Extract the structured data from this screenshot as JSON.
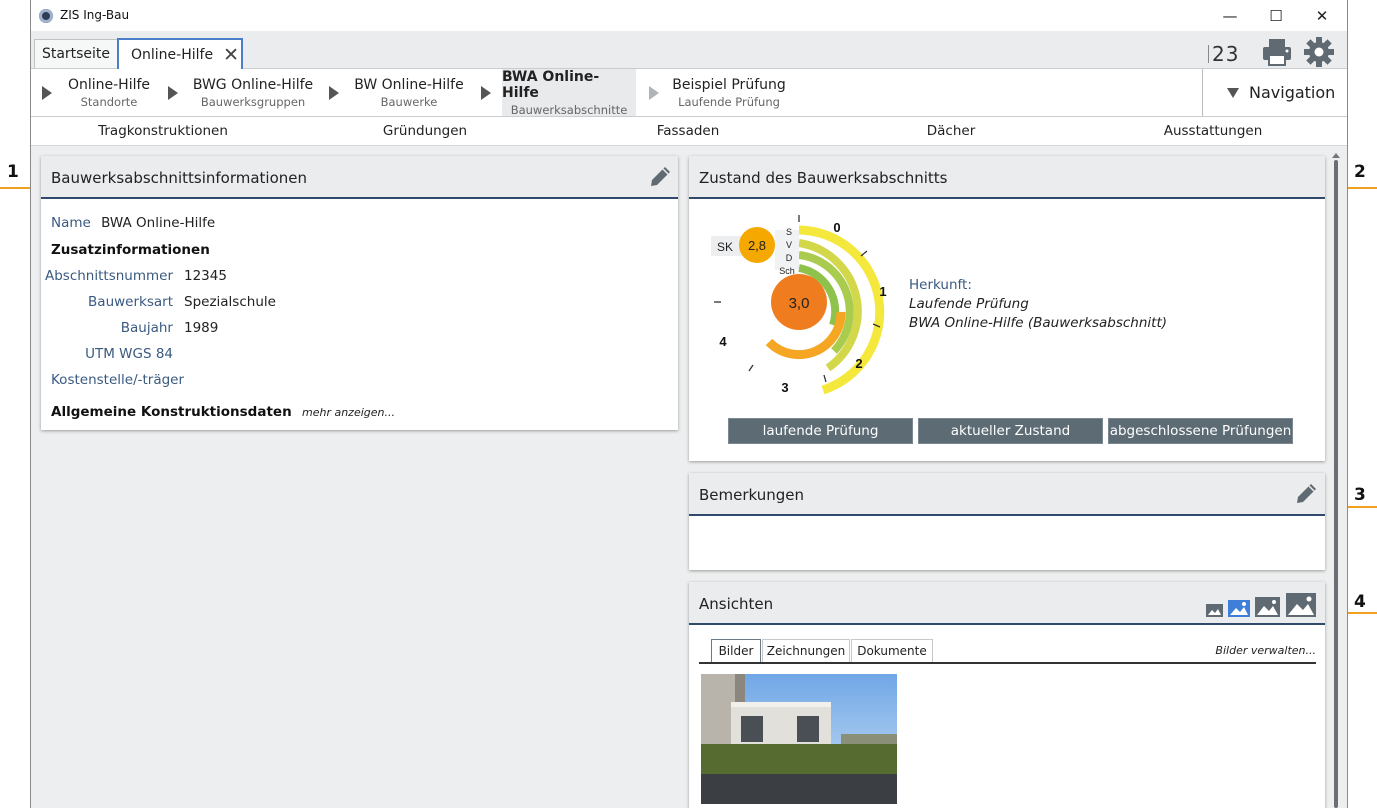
{
  "window": {
    "title": "ZIS Ing-Bau",
    "minimize": "—",
    "maximize": "☐",
    "close": "✕"
  },
  "tabs": {
    "start": "Startseite",
    "active": "Online-Hilfe",
    "close_glyph": "✕"
  },
  "toolbar": {
    "numbers": "23"
  },
  "breadcrumb": [
    {
      "title": "Online-Hilfe",
      "sub": "Standorte"
    },
    {
      "title": "BWG Online-Hilfe",
      "sub": "Bauwerksgruppen"
    },
    {
      "title": "BW Online-Hilfe",
      "sub": "Bauwerke"
    },
    {
      "title": "BWA Online-Hilfe",
      "sub": "Bauwerksabschnitte"
    },
    {
      "title": "Beispiel Prüfung",
      "sub": "Laufende Prüfung"
    }
  ],
  "navigation": {
    "label": "Navigation"
  },
  "categories": [
    "Tragkonstruktionen",
    "Gründungen",
    "Fassaden",
    "Dächer",
    "Ausstattungen"
  ],
  "info_panel": {
    "title": "Bauwerksabschnittsinformationen",
    "name_label": "Name",
    "name_value": "BWA Online-Hilfe",
    "zusatz": "Zusatzinformationen",
    "fields": [
      {
        "label": "Abschnittsnummer",
        "value": "12345"
      },
      {
        "label": "Bauwerksart",
        "value": "Spezialschule"
      },
      {
        "label": "Baujahr",
        "value": "1989"
      },
      {
        "label": "UTM WGS 84",
        "value": ""
      },
      {
        "label": "Kostenstelle/-träger",
        "value": ""
      }
    ],
    "allgemein": "Allgemeine Konstruktionsdaten",
    "mehr": "mehr anzeigen..."
  },
  "zustand_panel": {
    "title": "Zustand des Bauwerksabschnitts",
    "sk_label": "SK",
    "sk_value": "2,8",
    "center_value": "3,0",
    "ring_labels": [
      "S",
      "V",
      "D",
      "Sch"
    ],
    "scale_labels": [
      "0",
      "1",
      "2",
      "3",
      "4"
    ],
    "herkunft_label": "Herkunft:",
    "herkunft_line1": "Laufende Prüfung",
    "herkunft_line2": "BWA Online-Hilfe (Bauwerksabschnitt)",
    "buttons": [
      "laufende Prüfung",
      "aktueller Zustand",
      "abgeschlossene Prüfungen"
    ],
    "colors": {
      "ring_s": "#f5e83c",
      "ring_v": "#d2d84a",
      "ring_d": "#a9cc4e",
      "ring_sch": "#8fc24a",
      "center": "#ef7d1f",
      "sk_badge": "#f5a900"
    }
  },
  "bemerkungen_panel": {
    "title": "Bemerkungen"
  },
  "ansichten_panel": {
    "title": "Ansichten",
    "tabs": [
      "Bilder",
      "Zeichnungen",
      "Dokumente"
    ],
    "manage": "Bilder verwalten...",
    "image_icons": [
      "image-small-icon",
      "image-medium-icon",
      "image-large-icon",
      "image-xlarge-icon"
    ]
  },
  "callouts": [
    "1",
    "2",
    "3",
    "4"
  ]
}
